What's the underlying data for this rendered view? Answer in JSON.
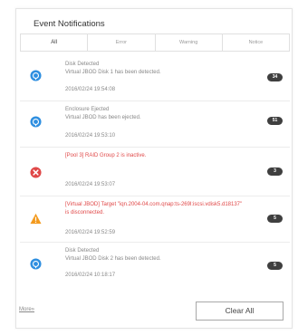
{
  "panel": {
    "title": "Event Notifications",
    "tabs": [
      {
        "label": "All",
        "active": true
      },
      {
        "label": "Error",
        "active": false
      },
      {
        "label": "Warning",
        "active": false
      },
      {
        "label": "Notice",
        "active": false
      }
    ]
  },
  "events": [
    {
      "icon": "info-icon",
      "severity": "notice",
      "message": "Disk Detected\nVirtual JBOD Disk 1 has been detected.",
      "time": "2016/02/24 19:54:08",
      "count": "34"
    },
    {
      "icon": "info-icon",
      "severity": "notice",
      "message": "Enclosure Ejected\nVirtual JBOD has been ejected.",
      "time": "2016/02/24 19:53:10",
      "count": "51"
    },
    {
      "icon": "error-icon",
      "severity": "error",
      "message": "[Pool 3] RAID Group 2 is inactive.",
      "time": "2016/02/24 19:53:07",
      "count": "3"
    },
    {
      "icon": "warning-icon",
      "severity": "warning",
      "message": "[Virtual JBOD] Target \"iqn.2004-04.com.qnap:ts-269l:iscsi.vdisk5.d18137\" is disconnected.",
      "time": "2016/02/24 19:52:59",
      "count": "5"
    },
    {
      "icon": "info-icon",
      "severity": "notice",
      "message": "Disk Detected\nVirtual JBOD Disk 2 has been detected.",
      "time": "2016/02/24 10:18:17",
      "count": "5"
    }
  ],
  "footer": {
    "more_label": "More»",
    "clear_label": "Clear All"
  },
  "colors": {
    "info": "#2f8fe0",
    "error": "#e04848",
    "warning": "#f39a1e",
    "badge": "#3f3f3f"
  }
}
